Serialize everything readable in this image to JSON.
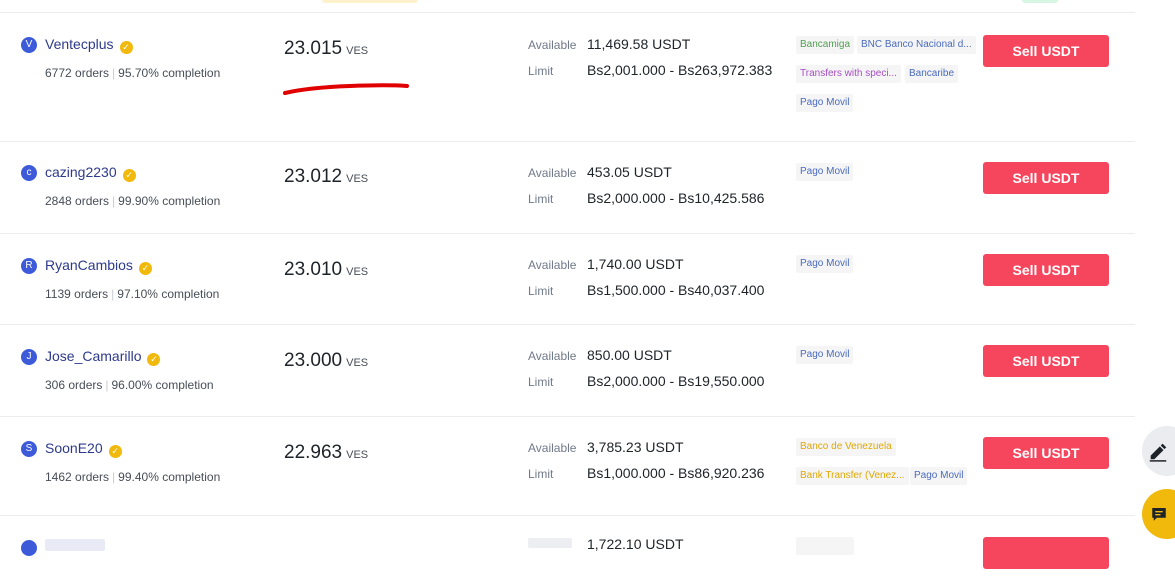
{
  "colors": {
    "buy_sell_accent": "#f6465d",
    "verified_badge": "#f0b90b",
    "avatar_bg": "#3d5bd9",
    "chip_green": "#4f9d4f",
    "chip_blue": "#4a6bbd",
    "chip_purple": "#a74fc4",
    "chip_yellow": "#e0a800",
    "underline_annotation": "#e00000"
  },
  "rows": [
    {
      "avatar": "V",
      "name": "Ventecplus",
      "orders": "6772 orders",
      "completion": "95.70% completion",
      "price": "23.015",
      "currency": "VES",
      "available_label": "Available",
      "available": "11,469.58 USDT",
      "limit_label": "Limit",
      "limit": "Bs2,001.000 - Bs263,972.383",
      "payments": [
        "Bancamiga",
        "BNC Banco Nacional d...",
        "Transfers with speci...",
        "Bancaribe",
        "Pago Movil"
      ],
      "button": "Sell USDT"
    },
    {
      "avatar": "c",
      "name": "cazing2230",
      "orders": "2848 orders",
      "completion": "99.90% completion",
      "price": "23.012",
      "currency": "VES",
      "available_label": "Available",
      "available": "453.05 USDT",
      "limit_label": "Limit",
      "limit": "Bs2,000.000 - Bs10,425.586",
      "payments": [
        "Pago Movil"
      ],
      "button": "Sell USDT"
    },
    {
      "avatar": "R",
      "name": "RyanCambios",
      "orders": "1139 orders",
      "completion": "97.10% completion",
      "price": "23.010",
      "currency": "VES",
      "available_label": "Available",
      "available": "1,740.00 USDT",
      "limit_label": "Limit",
      "limit": "Bs1,500.000 - Bs40,037.400",
      "payments": [
        "Pago Movil"
      ],
      "button": "Sell USDT"
    },
    {
      "avatar": "J",
      "name": "Jose_Camarillo",
      "orders": "306 orders",
      "completion": "96.00% completion",
      "price": "23.000",
      "currency": "VES",
      "available_label": "Available",
      "available": "850.00 USDT",
      "limit_label": "Limit",
      "limit": "Bs2,000.000 - Bs19,550.000",
      "payments": [
        "Pago Movil"
      ],
      "button": "Sell USDT"
    },
    {
      "avatar": "S",
      "name": "SoonE20",
      "orders": "1462 orders",
      "completion": "99.40% completion",
      "price": "22.963",
      "currency": "VES",
      "available_label": "Available",
      "available": "3,785.23 USDT",
      "limit_label": "Limit",
      "limit": "Bs1,000.000 - Bs86,920.236",
      "payments": [
        "Banco de Venezuela",
        "Bank Transfer (Venez...",
        "Pago Movil"
      ],
      "button": "Sell USDT"
    },
    {
      "available": "1,722.10 USDT"
    }
  ],
  "fab": {
    "edit_icon": "pencil-icon",
    "chat_icon": "chat-icon"
  }
}
